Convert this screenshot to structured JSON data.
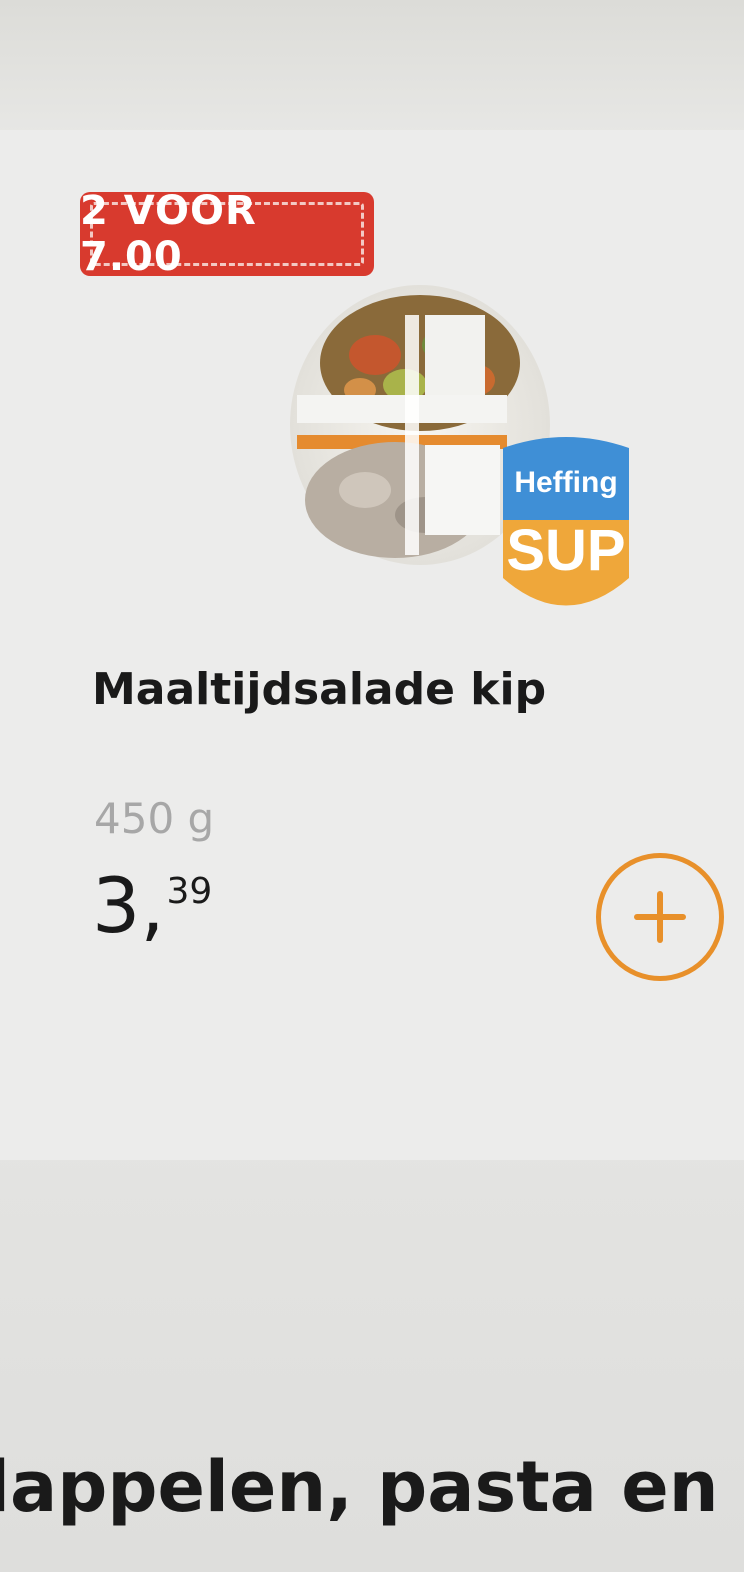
{
  "product": {
    "promo_label": "2 VOOR 7.00",
    "name": "Maaltijdsalade kip",
    "weight": "450 g",
    "price_whole": "3",
    "price_separator": ",",
    "price_cents": "39",
    "image_icon": "salad-bowl-image",
    "brand_logo": {
      "icon": "brand-logo",
      "text_top": "Heffing",
      "text_bottom": "SUP"
    },
    "add_icon": "plus-icon"
  },
  "next_section": {
    "heading": "lappelen, pasta en"
  },
  "colors": {
    "promo_red": "#d83a2e",
    "accent_orange": "#e8902a",
    "logo_blue": "#3f8fd6",
    "logo_orange": "#efa73a",
    "text_dark": "#1a1a1a",
    "text_muted": "#a7a7a7"
  }
}
